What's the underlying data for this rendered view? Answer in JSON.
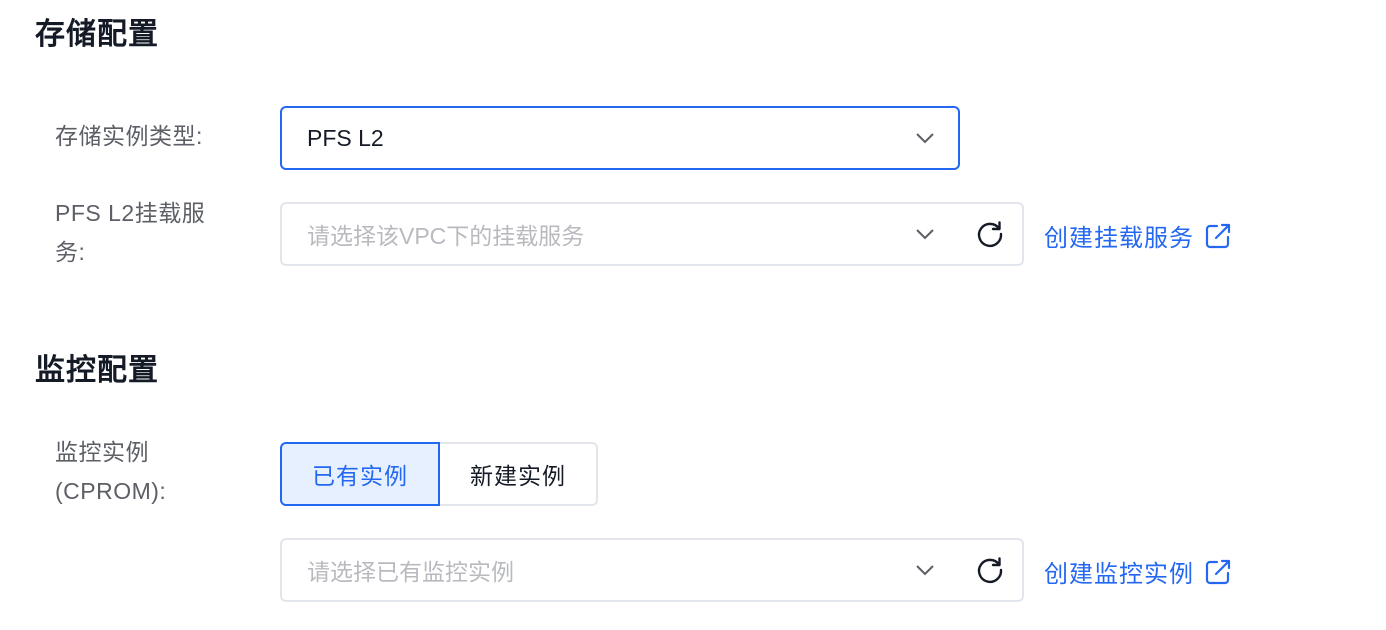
{
  "storage": {
    "title": "存储配置",
    "instance_type_label": "存储实例类型:",
    "instance_type_value": "PFS L2",
    "mount_label_line1": "PFS L2挂载服",
    "mount_label_line2": "务:",
    "mount_placeholder": "请选择该VPC下的挂载服务",
    "create_mount_link": "创建挂载服务"
  },
  "monitor": {
    "title": "监控配置",
    "instance_label_line1": "监控实例",
    "instance_label_line2": "(CPROM):",
    "segments": [
      "已有实例",
      "新建实例"
    ],
    "selected_segment": "已有实例",
    "instance_placeholder": "请选择已有监控实例",
    "create_instance_link": "创建监控实例"
  },
  "colors": {
    "accent": "#2468f2",
    "border": "#e2e5ec",
    "placeholder": "#b8babf",
    "label": "#5c5f66"
  },
  "icons": {
    "dropdown": "chevron-down-icon",
    "refresh": "refresh-icon",
    "external": "external-link-icon"
  }
}
